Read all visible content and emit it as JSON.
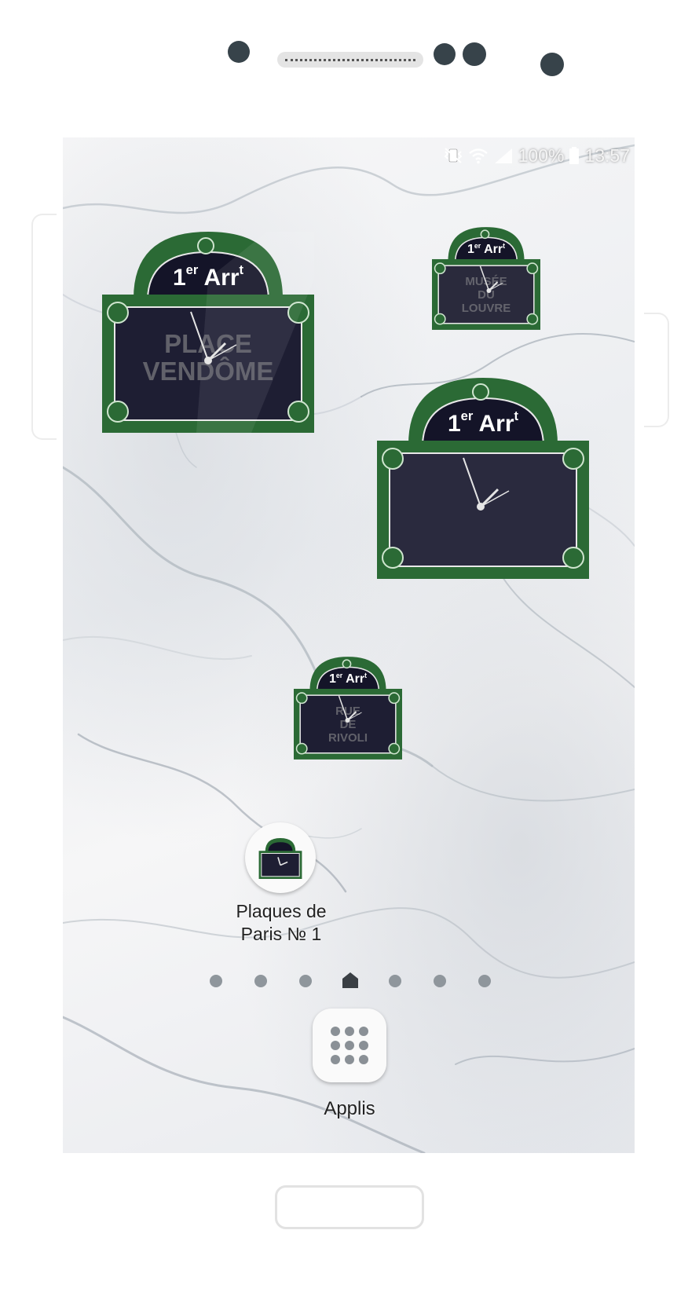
{
  "status_bar": {
    "battery": "100%",
    "time": "13:57",
    "icons": [
      "mute-vibrate-icon",
      "wifi-icon",
      "signal-icon",
      "battery-icon"
    ]
  },
  "widgets": [
    {
      "arrondissement_num": "1",
      "arrondissement_sup": "er",
      "arrondissement_word": "Arr",
      "arrondissement_word_sup": "t",
      "street": [
        "PLACE",
        "VENDÔME"
      ]
    },
    {
      "arrondissement_num": "1",
      "arrondissement_sup": "er",
      "arrondissement_word": "Arr",
      "arrondissement_word_sup": "t",
      "street": [
        "MUSÉE",
        "DU",
        "LOUVRE"
      ]
    },
    {
      "arrondissement_num": "1",
      "arrondissement_sup": "er",
      "arrondissement_word": "Arr",
      "arrondissement_word_sup": "t",
      "street": []
    },
    {
      "arrondissement_num": "1",
      "arrondissement_sup": "er",
      "arrondissement_word": "Arr",
      "arrondissement_word_sup": "t",
      "street": [
        "RUE",
        "DE",
        "RIVOLI"
      ]
    }
  ],
  "app_shortcut": {
    "label": "Plaques de Paris № 1"
  },
  "pager": {
    "pages": 7,
    "current_home_index": 3
  },
  "apps_button": {
    "label": "Applis"
  },
  "colors": {
    "sign_green": "#2b6a35",
    "sign_plate": "#1f1f35",
    "dot": "#8f969c"
  }
}
